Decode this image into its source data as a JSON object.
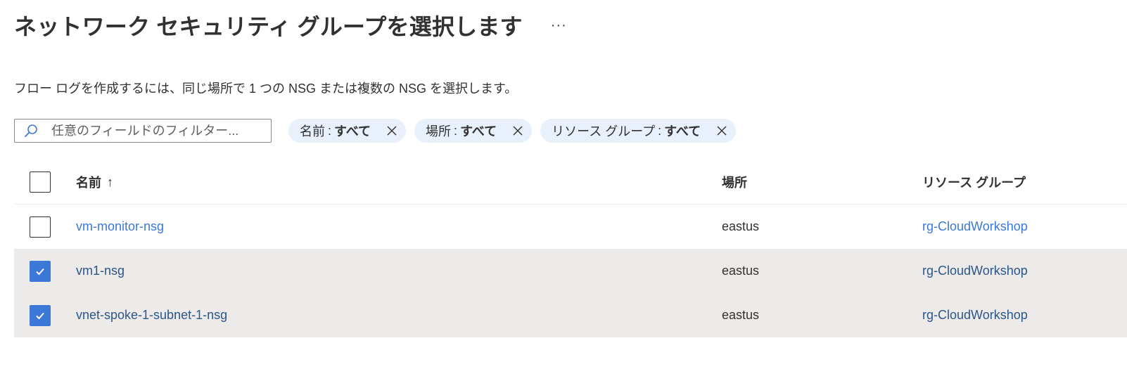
{
  "header": {
    "title": "ネットワーク セキュリティ グループを選択します",
    "more_label": "···"
  },
  "description": "フロー ログを作成するには、同じ場所で 1 つの NSG または複数の NSG を選択します。",
  "search": {
    "placeholder": "任意のフィールドのフィルター...",
    "value": ""
  },
  "filters": [
    {
      "key": "名前",
      "sep": ":",
      "value": "すべて"
    },
    {
      "key": "場所",
      "sep": ":",
      "value": "すべて"
    },
    {
      "key": "リソース グループ",
      "sep": ":",
      "value": "すべて"
    }
  ],
  "table": {
    "columns": {
      "name": "名前",
      "name_sort": "↑",
      "location": "場所",
      "resource_group": "リソース グループ"
    },
    "rows": [
      {
        "name": "vm-monitor-nsg",
        "location": "eastus",
        "resource_group": "rg-CloudWorkshop",
        "selected": false
      },
      {
        "name": "vm1-nsg",
        "location": "eastus",
        "resource_group": "rg-CloudWorkshop",
        "selected": true
      },
      {
        "name": "vnet-spoke-1-subnet-1-nsg",
        "location": "eastus",
        "resource_group": "rg-CloudWorkshop",
        "selected": true
      }
    ]
  },
  "colors": {
    "accent": "#3b78d8",
    "selected_row": "#edebe9",
    "pill_bg": "#e8f0fb"
  },
  "icons": {
    "search": "search-icon",
    "close": "close-icon",
    "check": "checkmark-icon"
  }
}
